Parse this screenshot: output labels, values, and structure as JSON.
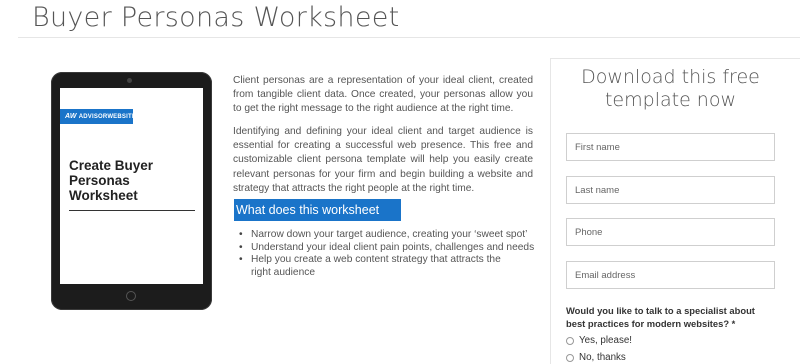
{
  "page": {
    "title": "Buyer Personas Worksheet"
  },
  "cover": {
    "logo_text": "ADVISORWEBSITES™",
    "logo_mark": "AW",
    "title": "Create Buyer Personas Worksheet"
  },
  "content": {
    "paragraph1": "Client personas are a representation of your ideal client, created from tangible client data. Once created, your personas allow you to get the right message to the right audience at the right time.",
    "paragraph2": "Identifying and defining your ideal client and target audience is essential for creating a successful web presence. This free and customizable client persona template will help you easily create relevant personas for your firm and begin building a website and strategy that attracts the right people at the right time.",
    "section_heading": "What does this worksheet do?",
    "bullets": [
      "Narrow down your target audience, creating your ‘sweet spot’",
      "Understand your ideal client pain points, challenges and needs",
      "Help you create a web content strategy that attracts the right audience"
    ]
  },
  "form": {
    "heading": "Download this free template now",
    "fields": [
      {
        "placeholder": "First name",
        "value": ""
      },
      {
        "placeholder": "Last name",
        "value": ""
      },
      {
        "placeholder": "Phone",
        "value": ""
      },
      {
        "placeholder": "Email address",
        "value": ""
      }
    ],
    "question": "Would you like to talk to a specialist about best practices for modern websites? *",
    "options": [
      "Yes, please!",
      "No, thanks"
    ]
  },
  "colors": {
    "accent": "#1a74c9",
    "text": "#555555",
    "tablet": "#1c1c1c"
  }
}
